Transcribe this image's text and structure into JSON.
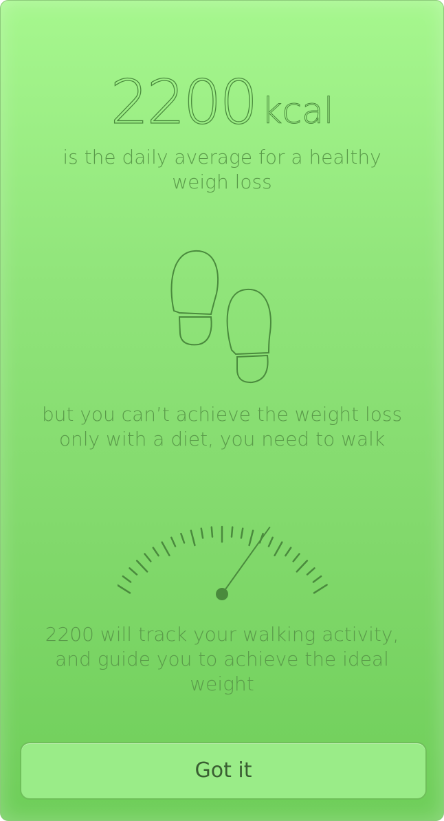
{
  "hero": {
    "number": "2200",
    "unit": "kcal"
  },
  "intro": {
    "lines": [
      "is the daily average for a healthy",
      "weigh loss"
    ]
  },
  "walk": {
    "lines": [
      "but you can’t achieve the weight loss",
      "only with a diet, you need to walk"
    ]
  },
  "track": {
    "lines": [
      "2200 will track your walking activity,",
      "and guide you to achieve the ideal",
      "weight"
    ]
  },
  "gauge": {
    "level": 0.78
  },
  "actions": {
    "confirm_label": "Got it"
  },
  "colors": {
    "background": "#90e47a",
    "ink": "#4a8a3d",
    "button": "#9aec88"
  },
  "icons": [
    "footprints-icon",
    "gauge-icon"
  ]
}
